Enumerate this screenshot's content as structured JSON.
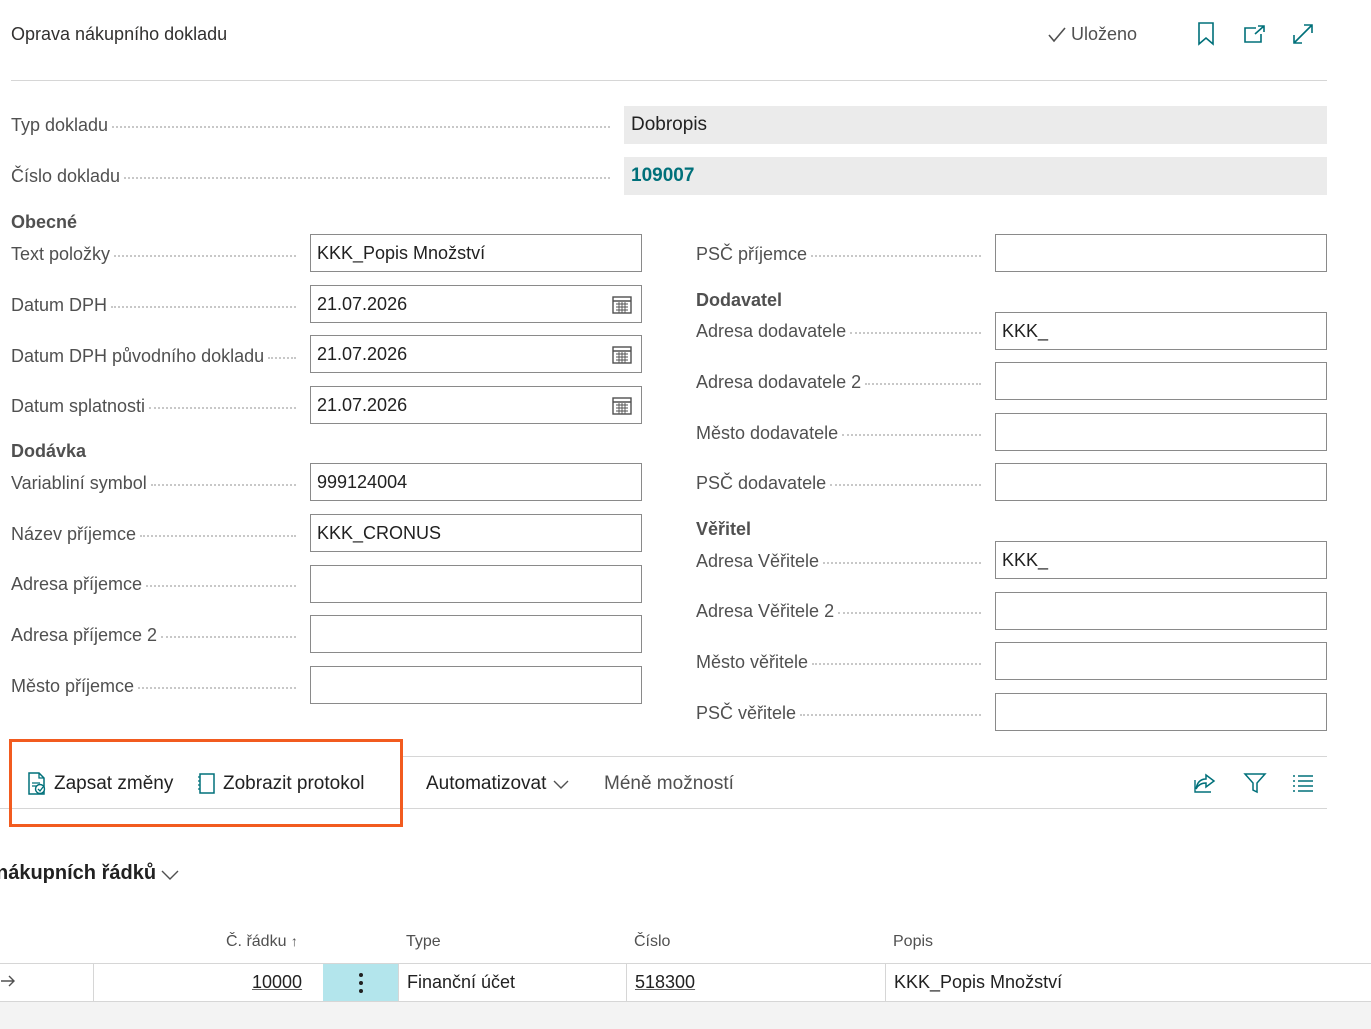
{
  "header": {
    "title": "Oprava nákupního dokladu",
    "saved_label": "Uloženo"
  },
  "top_fields": [
    {
      "label": "Typ dokladu",
      "value": "Dobropis"
    },
    {
      "label": "Číslo dokladu",
      "value": "109007"
    }
  ],
  "left": {
    "section_general": "Obecné",
    "text_polozky": {
      "label": "Text položky",
      "value": "KKK_Popis Množství"
    },
    "datum_dph": {
      "label": "Datum DPH",
      "value": "21.07.2026"
    },
    "datum_dph_puvodni": {
      "label": "Datum DPH původního dokladu",
      "value": "21.07.2026"
    },
    "datum_splatnosti": {
      "label": "Datum splatnosti",
      "value": "21.07.2026"
    },
    "section_delivery": "Dodávka",
    "variabilni_symbol": {
      "label": "Variabliní symbol",
      "value": "999124004"
    },
    "nazev_prijemce": {
      "label": "Název příjemce",
      "value": "KKK_CRONUS"
    },
    "adresa_prijemce": {
      "label": "Adresa příjemce",
      "value": ""
    },
    "adresa_prijemce2": {
      "label": "Adresa příjemce 2",
      "value": ""
    },
    "mesto_prijemce": {
      "label": "Město příjemce",
      "value": ""
    }
  },
  "right": {
    "psc_prijemce": {
      "label": "PSČ příjemce",
      "value": ""
    },
    "section_vendor": "Dodavatel",
    "adresa_dodavatele": {
      "label": "Adresa dodavatele",
      "value": "KKK_"
    },
    "adresa_dodavatele2": {
      "label": "Adresa dodavatele 2",
      "value": ""
    },
    "mesto_dodavatele": {
      "label": "Město dodavatele",
      "value": ""
    },
    "psc_dodavatele": {
      "label": "PSČ dodavatele",
      "value": ""
    },
    "section_creditor": "Věřitel",
    "adresa_veritele": {
      "label": "Adresa Věřitele",
      "value": "KKK_"
    },
    "adresa_veritele2": {
      "label": "Adresa Věřitele 2",
      "value": ""
    },
    "mesto_veritele": {
      "label": "Město věřitele",
      "value": ""
    },
    "psc_veritele": {
      "label": "PSČ věřitele",
      "value": ""
    }
  },
  "actions": {
    "write_changes": "Zapsat změny",
    "show_log": "Zobrazit protokol",
    "automate": "Automatizovat",
    "fewer_options": "Méně možností"
  },
  "lines": {
    "title": "nákupních řádků",
    "columns": {
      "line_no": "Č. řádku",
      "type": "Type",
      "number": "Číslo",
      "description": "Popis"
    },
    "rows": [
      {
        "line_no": "10000",
        "type": "Finanční účet",
        "number": "518300",
        "description": "KKK_Popis Množství"
      }
    ]
  },
  "colors": {
    "accent": "#00707a",
    "highlight_border": "#f25b1f",
    "selected_cell": "#b3e5ec"
  }
}
